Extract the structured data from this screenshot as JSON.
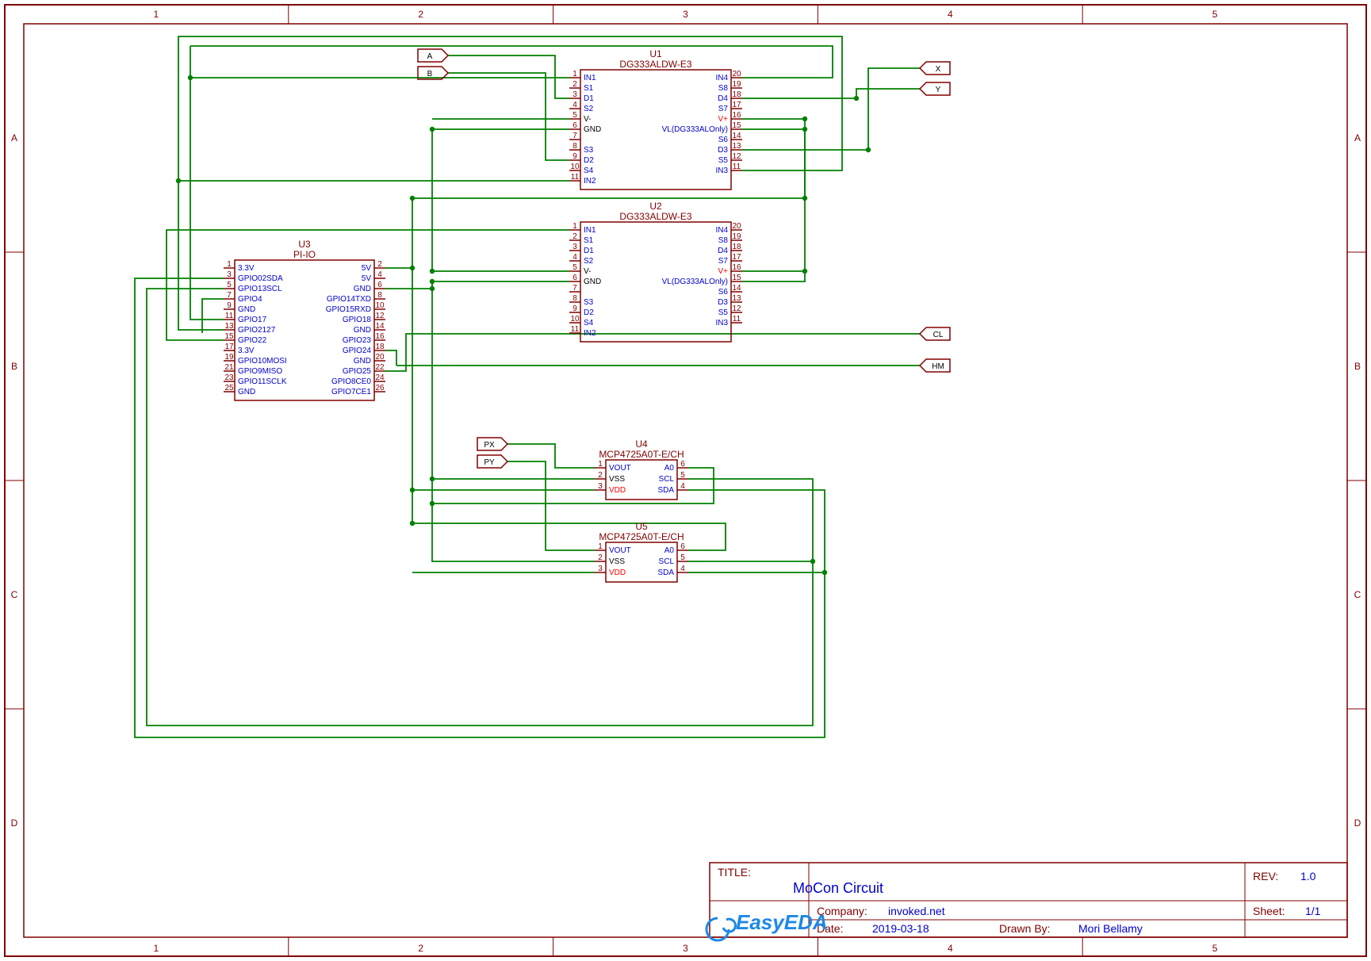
{
  "frame": {
    "cols": [
      "1",
      "2",
      "3",
      "4",
      "5"
    ],
    "rows": [
      "A",
      "B",
      "C",
      "D"
    ]
  },
  "title_block": {
    "title_label": "TITLE:",
    "title": "MoCon Circuit",
    "rev_label": "REV:",
    "rev": "1.0",
    "company_label": "Company:",
    "company": "invoked.net",
    "sheet_label": "Sheet:",
    "sheet": "1/1",
    "date_label": "Date:",
    "date": "2019-03-18",
    "drawn_by_label": "Drawn By:",
    "drawn_by": "Mori Bellamy",
    "logo": "EasyEDA"
  },
  "components": {
    "U1": {
      "ref": "U1",
      "part": "DG333ALDW-E3",
      "left": [
        {
          "n": "1",
          "name": "IN1"
        },
        {
          "n": "2",
          "name": "S1"
        },
        {
          "n": "3",
          "name": "D1"
        },
        {
          "n": "4",
          "name": "S2"
        },
        {
          "n": "5",
          "name": "V-",
          "k": true
        },
        {
          "n": "6",
          "name": "GND",
          "k": true
        },
        {
          "n": "7",
          "name": ""
        },
        {
          "n": "8",
          "name": "S3"
        },
        {
          "n": "9",
          "name": "D2"
        },
        {
          "n": "10",
          "name": "S4"
        },
        {
          "n": "11",
          "name": "IN2"
        }
      ],
      "right": [
        {
          "n": "20",
          "name": "IN4"
        },
        {
          "n": "19",
          "name": "S8"
        },
        {
          "n": "18",
          "name": "D4"
        },
        {
          "n": "17",
          "name": "S7"
        },
        {
          "n": "16",
          "name": "V+",
          "pwr": true
        },
        {
          "n": "15",
          "name": "VL(DG333ALOnly)"
        },
        {
          "n": "14",
          "name": "S6"
        },
        {
          "n": "13",
          "name": "D3"
        },
        {
          "n": "12",
          "name": "S5"
        },
        {
          "n": "11",
          "name": "IN3"
        }
      ]
    },
    "U2": {
      "ref": "U2",
      "part": "DG333ALDW-E3",
      "left": [
        {
          "n": "1",
          "name": "IN1"
        },
        {
          "n": "2",
          "name": "S1"
        },
        {
          "n": "3",
          "name": "D1"
        },
        {
          "n": "4",
          "name": "S2"
        },
        {
          "n": "5",
          "name": "V-",
          "k": true
        },
        {
          "n": "6",
          "name": "GND",
          "k": true
        },
        {
          "n": "7",
          "name": ""
        },
        {
          "n": "8",
          "name": "S3"
        },
        {
          "n": "9",
          "name": "D2"
        },
        {
          "n": "10",
          "name": "S4"
        },
        {
          "n": "11",
          "name": "IN2"
        }
      ],
      "right": [
        {
          "n": "20",
          "name": "IN4"
        },
        {
          "n": "19",
          "name": "S8"
        },
        {
          "n": "18",
          "name": "D4"
        },
        {
          "n": "17",
          "name": "S7"
        },
        {
          "n": "16",
          "name": "V+",
          "pwr": true
        },
        {
          "n": "15",
          "name": "VL(DG333ALOnly)"
        },
        {
          "n": "14",
          "name": "S6"
        },
        {
          "n": "13",
          "name": "D3"
        },
        {
          "n": "12",
          "name": "S5"
        },
        {
          "n": "11",
          "name": "IN3"
        }
      ]
    },
    "U3": {
      "ref": "U3",
      "part": "PI-IO",
      "left": [
        {
          "n": "1",
          "name": "3.3V"
        },
        {
          "n": "3",
          "name": "GPIO02SDA"
        },
        {
          "n": "5",
          "name": "GPIO13SCL"
        },
        {
          "n": "7",
          "name": "GPIO4"
        },
        {
          "n": "9",
          "name": "GND"
        },
        {
          "n": "11",
          "name": "GPIO17"
        },
        {
          "n": "13",
          "name": "GPIO2127"
        },
        {
          "n": "15",
          "name": "GPIO22"
        },
        {
          "n": "17",
          "name": "3.3V"
        },
        {
          "n": "19",
          "name": "GPIO10MOSI"
        },
        {
          "n": "21",
          "name": "GPIO9MISO"
        },
        {
          "n": "23",
          "name": "GPIO11SCLK"
        },
        {
          "n": "25",
          "name": "GND"
        }
      ],
      "right": [
        {
          "n": "2",
          "name": "5V"
        },
        {
          "n": "4",
          "name": "5V"
        },
        {
          "n": "6",
          "name": "GND"
        },
        {
          "n": "8",
          "name": "GPIO14TXD"
        },
        {
          "n": "10",
          "name": "GPIO15RXD"
        },
        {
          "n": "12",
          "name": "GPIO18"
        },
        {
          "n": "14",
          "name": "GND"
        },
        {
          "n": "16",
          "name": "GPIO23"
        },
        {
          "n": "18",
          "name": "GPIO24"
        },
        {
          "n": "20",
          "name": "GND"
        },
        {
          "n": "22",
          "name": "GPIO25"
        },
        {
          "n": "24",
          "name": "GPIO8CE0"
        },
        {
          "n": "26",
          "name": "GPIO7CE1"
        }
      ]
    },
    "U4": {
      "ref": "U4",
      "part": "MCP4725A0T-E/CH",
      "left": [
        {
          "n": "1",
          "name": "VOUT"
        },
        {
          "n": "2",
          "name": "VSS",
          "k": true
        },
        {
          "n": "3",
          "name": "VDD",
          "pwr": true
        }
      ],
      "right": [
        {
          "n": "6",
          "name": "A0"
        },
        {
          "n": "5",
          "name": "SCL"
        },
        {
          "n": "4",
          "name": "SDA"
        }
      ]
    },
    "U5": {
      "ref": "U5",
      "part": "MCP4725A0T-E/CH",
      "left": [
        {
          "n": "1",
          "name": "VOUT"
        },
        {
          "n": "2",
          "name": "VSS",
          "k": true
        },
        {
          "n": "3",
          "name": "VDD",
          "pwr": true
        }
      ],
      "right": [
        {
          "n": "6",
          "name": "A0"
        },
        {
          "n": "5",
          "name": "SCL"
        },
        {
          "n": "4",
          "name": "SDA"
        }
      ]
    }
  },
  "netlabels": {
    "A": "A",
    "B": "B",
    "X": "X",
    "Y": "Y",
    "CL": "CL",
    "HM": "HM",
    "PX": "PX",
    "PY": "PY"
  }
}
